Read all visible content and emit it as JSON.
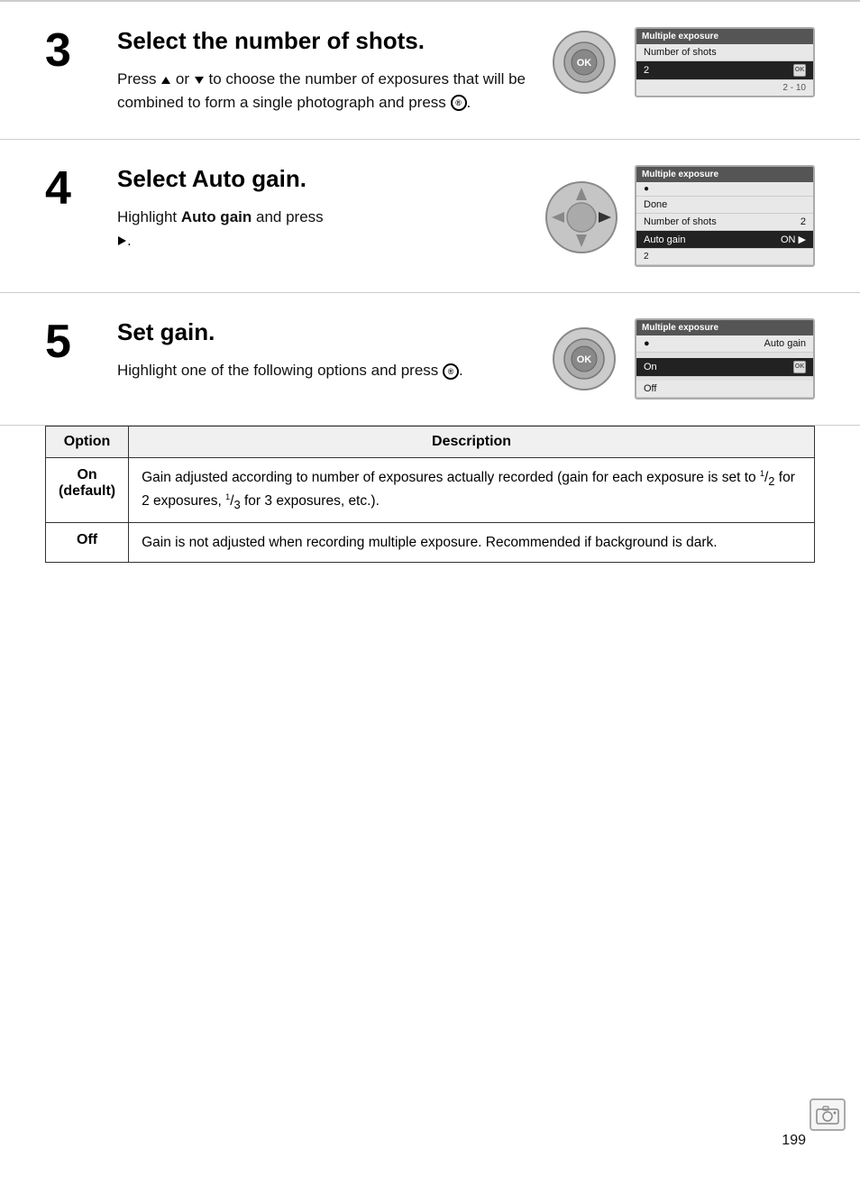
{
  "page": {
    "number": "199"
  },
  "section3": {
    "number": "3",
    "title": "Select the number of shots.",
    "body_part1": "Press ",
    "body_part2": " or ",
    "body_part3": " to choose the number of exposures that will be combined to form a single photograph and press ",
    "body_part4": ".",
    "screen": {
      "header": "Multiple exposure",
      "row1": "Number of shots",
      "value1": "2",
      "footer": "2 - 10"
    }
  },
  "section4": {
    "number": "4",
    "title_pre": "Select ",
    "title_bold": "Auto gain",
    "title_post": ".",
    "body_part1": "Highlight ",
    "body_bold": "Auto gain",
    "body_part2": " and press",
    "body_arrow": "▶",
    "body_part3": ".",
    "screen": {
      "header": "Multiple exposure",
      "row1": "Done",
      "row2": "Number of shots",
      "value2": "2",
      "row3": "Auto gain",
      "value3": "ON ▶"
    }
  },
  "section5": {
    "number": "5",
    "title": "Set gain.",
    "body_part1": "Highlight one of the following options and press ",
    "body_part2": ".",
    "screen": {
      "header": "Multiple exposure",
      "subheader": "Auto gain",
      "row1": "On",
      "row2": "Off"
    }
  },
  "table": {
    "col1_header": "Option",
    "col2_header": "Description",
    "rows": [
      {
        "option": "On\n(default)",
        "description": "Gain adjusted according to number of exposures actually recorded (gain for each exposure is set to ¹/₂ for 2 exposures, ¹/₃ for 3 exposures, etc.)."
      },
      {
        "option": "Off",
        "description": "Gain is not adjusted when recording multiple exposure. Recommended if background is dark."
      }
    ]
  }
}
